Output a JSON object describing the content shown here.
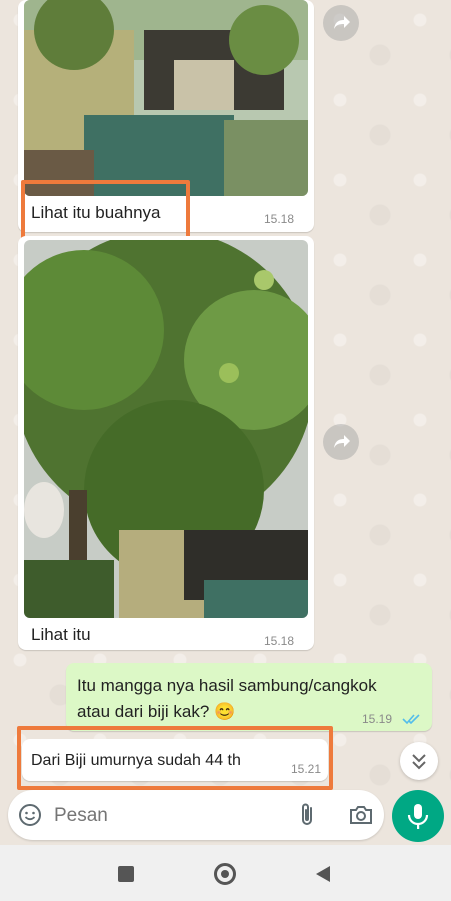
{
  "messages": [
    {
      "caption": "Lihat itu buahnya",
      "time": "15.18"
    },
    {
      "caption": "Lihat itu",
      "time": "15.18"
    },
    {
      "text_line1": "Itu mangga nya hasil sambung/cangkok",
      "text_line2": "atau dari biji kak?",
      "emoji": "😊",
      "time": "15.19"
    },
    {
      "caption": "Dari Biji umurnya sudah  44 th",
      "time": "15.21"
    }
  ],
  "input": {
    "placeholder": "Pesan"
  },
  "colors": {
    "highlight": "#ee7a3c",
    "outgoing": "#dcf8c6",
    "accent": "#00a884",
    "read_ticks": "#53bdeb"
  },
  "icons": [
    "forward-icon",
    "emoji-icon",
    "attach-icon",
    "camera-icon",
    "mic-icon",
    "scroll-down-icon",
    "nav-recents-icon",
    "nav-home-icon",
    "nav-back-icon"
  ]
}
